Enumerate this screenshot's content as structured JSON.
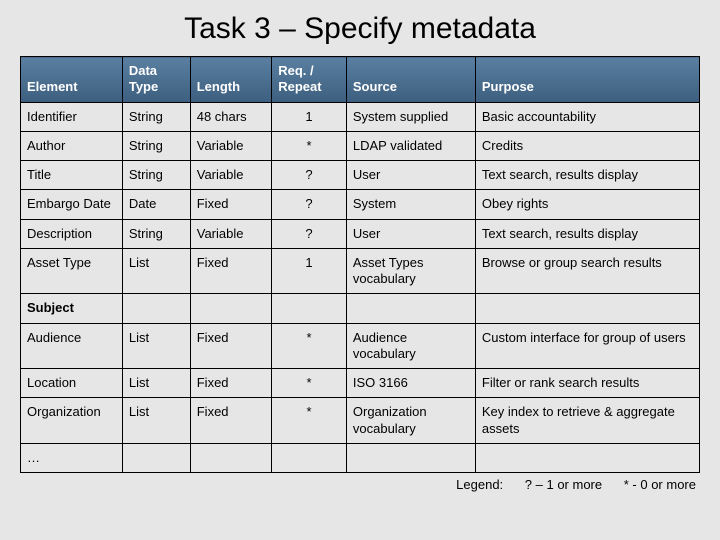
{
  "title": "Task 3 – Specify metadata",
  "headers": [
    "Element",
    "Data Type",
    "Length",
    "Req. / Repeat",
    "Source",
    "Purpose"
  ],
  "rows": [
    {
      "element": "Identifier",
      "dtype": "String",
      "length": "48 chars",
      "req": "1",
      "source": "System supplied",
      "purpose": "Basic accountability"
    },
    {
      "element": "Author",
      "dtype": "String",
      "length": "Variable",
      "req": "*",
      "source": "LDAP validated",
      "purpose": "Credits"
    },
    {
      "element": "Title",
      "dtype": "String",
      "length": "Variable",
      "req": "?",
      "source": "User",
      "purpose": "Text search, results display"
    },
    {
      "element": "Embargo Date",
      "dtype": "Date",
      "length": "Fixed",
      "req": "?",
      "source": "System",
      "purpose": "Obey rights"
    },
    {
      "element": "Description",
      "dtype": "String",
      "length": "Variable",
      "req": "?",
      "source": "User",
      "purpose": "Text search, results display"
    },
    {
      "element": "Asset Type",
      "dtype": "List",
      "length": "Fixed",
      "req": "1",
      "source": "Asset Types vocabulary",
      "purpose": "Browse or group search results"
    }
  ],
  "section": "Subject",
  "rows2": [
    {
      "element": "Audience",
      "dtype": "List",
      "length": "Fixed",
      "req": "*",
      "source": "Audience vocabulary",
      "purpose": "Custom interface for group of users"
    },
    {
      "element": "Location",
      "dtype": "List",
      "length": "Fixed",
      "req": "*",
      "source": "ISO 3166",
      "purpose": "Filter or rank search results"
    },
    {
      "element": "Organization",
      "dtype": "List",
      "length": "Fixed",
      "req": "*",
      "source": "Organization vocabulary",
      "purpose": "Key index to retrieve & aggregate assets"
    }
  ],
  "ellipsis": "…",
  "legend": {
    "label": "Legend:",
    "q": "? – 1 or more",
    "star": "* - 0 or more"
  }
}
